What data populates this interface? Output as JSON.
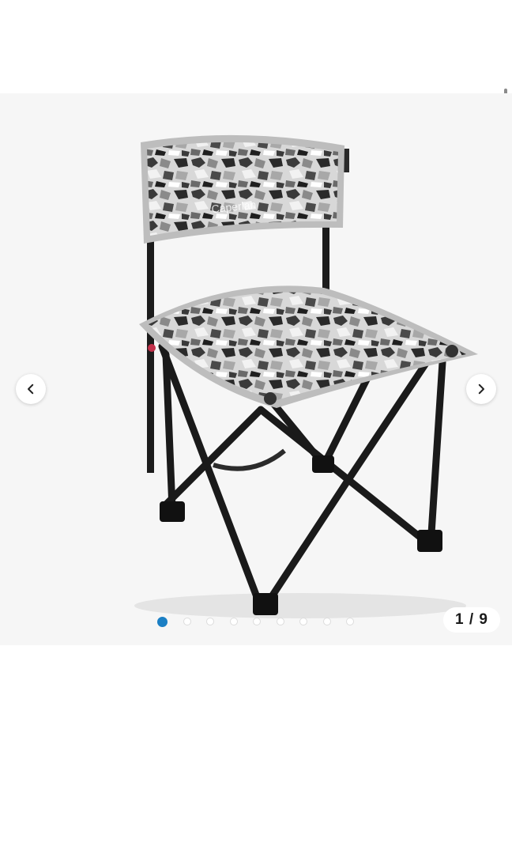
{
  "gallery": {
    "image_icon": "folding-camp-chair-photo",
    "brand_mark": "Caperlan",
    "prev_icon": "chevron-left-icon",
    "next_icon": "chevron-right-icon",
    "counter": "1 / 9",
    "total_images": 9,
    "active_index": 1,
    "accent_color": "#1b7fc4"
  }
}
